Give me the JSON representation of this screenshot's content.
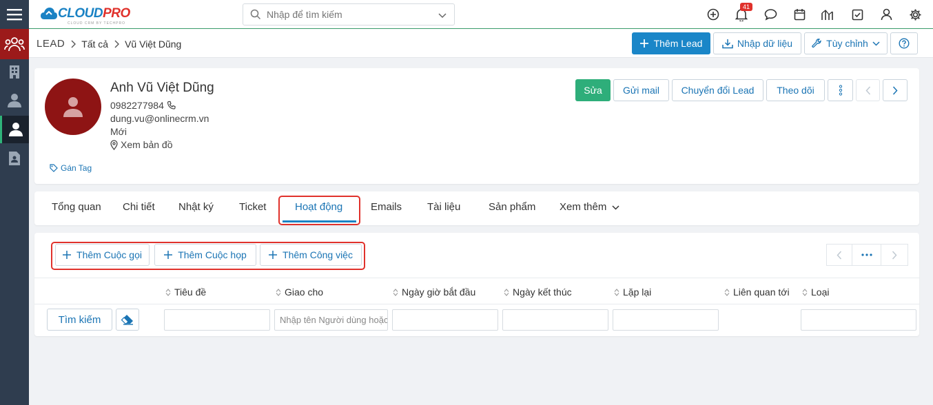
{
  "app": {
    "logo_main": "CLOUD",
    "logo_accent": "PRO",
    "logo_tagline": "CLOUD CRM BY TECHPRO"
  },
  "search": {
    "placeholder": "Nhập để tìm kiếm"
  },
  "notifications": {
    "count": "41"
  },
  "breadcrumb": {
    "module": "LEAD",
    "filter": "Tất cả",
    "record": "Vũ Việt Dũng"
  },
  "header_actions": {
    "add": "Thêm Lead",
    "import": "Nhập dữ liệu",
    "customize": "Tùy chỉnh"
  },
  "profile": {
    "name": "Anh Vũ Việt Dũng",
    "phone": "0982277984",
    "email": "dung.vu@onlinecrm.vn",
    "status": "Mới",
    "map": "Xem bản đồ",
    "tag": "Gán Tag"
  },
  "profile_actions": {
    "edit": "Sửa",
    "mail": "Gửi mail",
    "convert": "Chuyển đổi Lead",
    "follow": "Theo dõi"
  },
  "tabs": [
    {
      "label": "Tổng quan"
    },
    {
      "label": "Chi tiết"
    },
    {
      "label": "Nhật ký"
    },
    {
      "label": "Ticket"
    },
    {
      "label": "Hoạt động"
    },
    {
      "label": "Emails"
    },
    {
      "label": "Tài liệu"
    },
    {
      "label": "Sản phẩm"
    },
    {
      "label": "Xem thêm"
    }
  ],
  "activity_buttons": {
    "call": "Thêm Cuộc gọi",
    "meeting": "Thêm Cuộc họp",
    "task": "Thêm Công việc"
  },
  "columns": [
    {
      "label": "Tiêu đề"
    },
    {
      "label": "Giao cho"
    },
    {
      "label": "Ngày giờ bắt đầu"
    },
    {
      "label": "Ngày kết thúc"
    },
    {
      "label": "Lặp lại"
    },
    {
      "label": "Liên quan tới"
    },
    {
      "label": "Loại"
    }
  ],
  "filters": {
    "search_button": "Tìm kiếm",
    "assignee_placeholder": "Nhập tên Người dùng hoặc Nhóm"
  },
  "colors": {
    "primary": "#1a86c8",
    "success": "#2eae7a",
    "rail": "#2f3d4f",
    "avatar": "#8e1414",
    "highlight": "#e0312b"
  }
}
